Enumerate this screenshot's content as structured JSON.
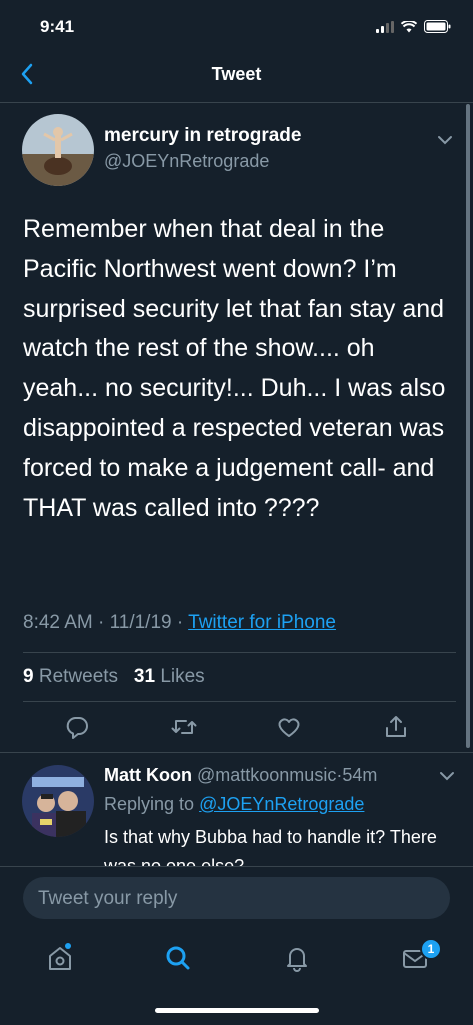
{
  "status_bar": {
    "time": "9:41"
  },
  "nav": {
    "title": "Tweet"
  },
  "tweet": {
    "author_name": "mercury in retrograde",
    "author_handle": "@JOEYnRetrograde",
    "text": "Remember when that deal in the Pacific Northwest went down? I’m surprised security let that fan stay and watch the rest of the show.... oh yeah... no security!... Duh... I was also disappointed a respected veteran was forced to make a judgement call- and THAT was called into ????",
    "time": "8:42 AM",
    "date": "11/1/19",
    "separator": "·",
    "source": "Twitter for iPhone",
    "retweets_count": "9",
    "retweets_label": "Retweets",
    "likes_count": "31",
    "likes_label": "Likes"
  },
  "reply": {
    "name": "Matt Koon",
    "handle": "@mattkoonmusic",
    "separator": "·",
    "time": "54m",
    "replying_prefix": "Replying to",
    "replying_to": "@JOEYnRetrograde",
    "text": "Is that why Bubba had to handle it? There was no one else?"
  },
  "compose": {
    "placeholder": "Tweet your reply"
  },
  "tab_bar": {
    "messages_badge": "1"
  },
  "colors": {
    "background": "#15202b",
    "accent": "#1da1f2",
    "secondary_text": "#8899a6",
    "divider": "#38444d"
  },
  "icons": [
    "back-chevron-icon",
    "chevron-down-icon",
    "reply-icon",
    "retweet-icon",
    "like-icon",
    "share-icon",
    "home-icon",
    "search-icon",
    "notifications-icon",
    "messages-icon"
  ]
}
